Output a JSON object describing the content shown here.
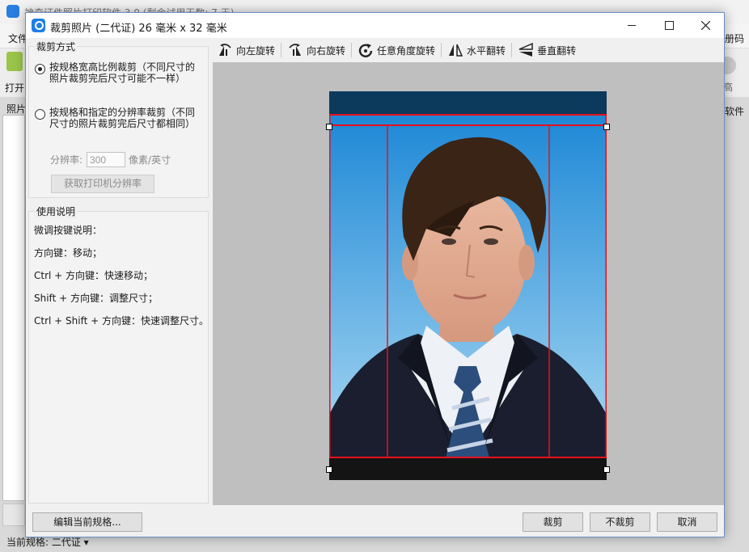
{
  "background_app": {
    "title": "神奇证件照片打印软件 3.0 (剩余试用天数: 7 天)",
    "menu_file": "文件",
    "menu_right": "册码",
    "toolbar_open": "打开",
    "toolbar_right": "高",
    "left_panel_title": "照片",
    "right_panel_title": "软件",
    "status_text": "当前规格: 二代证 ▾"
  },
  "dialog": {
    "title": "裁剪照片 (二代证) 26 毫米 x 32 毫米",
    "window_buttons": {
      "minimize": "minimize",
      "maximize": "maximize",
      "close": "close"
    }
  },
  "crop_mode": {
    "legend": "裁剪方式",
    "option1": "按规格宽高比例裁剪（不同尺寸的照片裁剪完后尺寸可能不一样）",
    "option2": "按规格和指定的分辨率裁剪（不同尺寸的照片裁剪完后尺寸都相同）",
    "selected": "option1",
    "resolution_label": "分辨率:",
    "resolution_value": "300",
    "resolution_unit": "像素/英寸",
    "printer_button": "获取打印机分辨率"
  },
  "help": {
    "legend": "使用说明",
    "lines": [
      "微调按键说明：",
      "方向键：移动；",
      "Ctrl + 方向键：快速移动；",
      "Shift + 方向键：调整尺寸；",
      "Ctrl + Shift + 方向键：快速调整尺寸。"
    ]
  },
  "toolbar": {
    "rotate_left": "向左旋转",
    "rotate_right": "向右旋转",
    "rotate_any": "任意角度旋转",
    "flip_h": "水平翻转",
    "flip_v": "垂直翻转"
  },
  "buttons": {
    "edit_spec": "编辑当前规格...",
    "crop": "裁剪",
    "no_crop": "不裁剪",
    "cancel": "取消"
  },
  "colors": {
    "crop_border": "#e8101c",
    "photo_bg_top": "#1e88d6",
    "photo_bg_bottom": "#a8d8f2",
    "suit": "#1a1e2e"
  },
  "icons": {
    "app": "app-icon",
    "rotate_left": "rotate-left-icon",
    "rotate_right": "rotate-right-icon",
    "rotate_any": "rotate-any-icon",
    "flip_h": "flip-horizontal-icon",
    "flip_v": "flip-vertical-icon"
  }
}
